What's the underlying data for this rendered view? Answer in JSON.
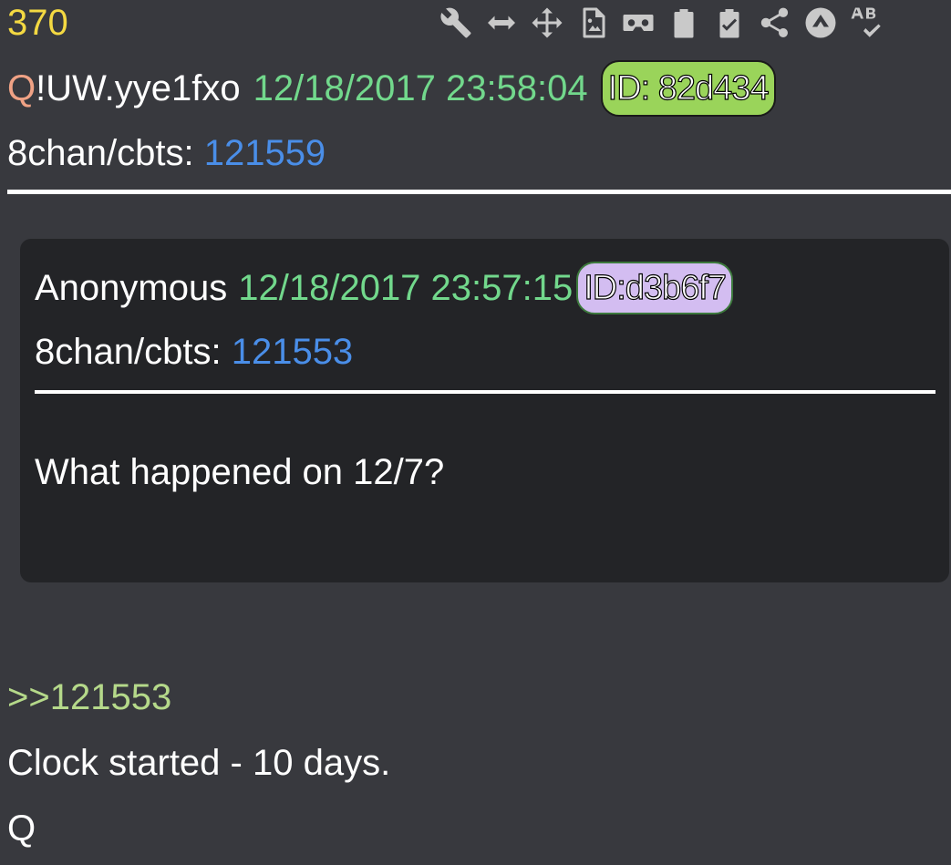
{
  "post": {
    "number": "370",
    "trip_q": "Q",
    "trip_code": "!UW.yye1fxo",
    "timestamp": "12/18/2017 23:58:04",
    "id_label": "ID: 82d434",
    "board_label": "8chan/cbts:",
    "post_link": "121559",
    "id_color": "#9ad45a"
  },
  "toolbar": {
    "icons": [
      "wrench-icon",
      "resize-horizontal-icon",
      "move-icon",
      "image-file-icon",
      "vr-headset-icon",
      "clipboard-icon",
      "clipboard-check-icon",
      "share-icon",
      "arrow-up-circle-icon",
      "spellcheck-icon"
    ]
  },
  "quoted": {
    "author": "Anonymous",
    "timestamp": "12/18/2017 23:57:15",
    "id_label": "ID:d3b6f7",
    "board_label": "8chan/cbts:",
    "post_link": "121553",
    "body": "What happened on 12/7?",
    "id_color": "#d3bdf1"
  },
  "reply": {
    "link": ">>121553",
    "line1": "Clock started - 10 days.",
    "line2": "Q"
  },
  "colors": {
    "background": "#38393e",
    "quote_background": "#232427",
    "post_number": "#f4d942",
    "timestamp": "#72d88c",
    "link": "#4a8ee8",
    "greentext": "#b5d98a",
    "trip_q": "#f0a285"
  }
}
